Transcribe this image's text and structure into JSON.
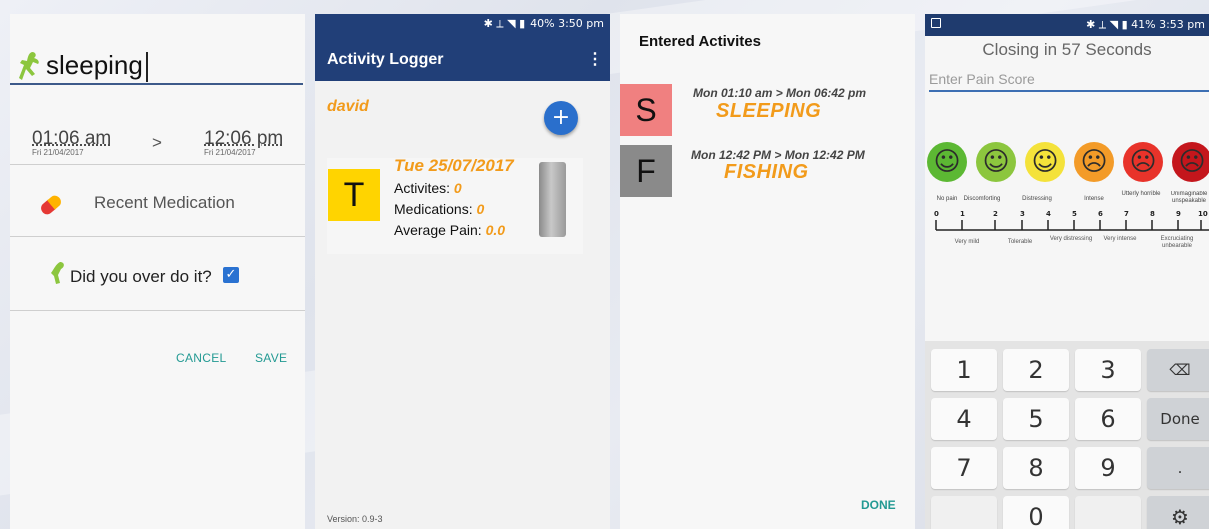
{
  "screen1": {
    "title": "sleeping",
    "start_time": "01:06 am",
    "start_date": "Fri 21/04/2017",
    "arrow": ">",
    "end_time": "12:06 pm",
    "end_date": "Fri 21/04/2017",
    "medication_label": "Recent Medication",
    "overdo_label": "Did you over do it?",
    "overdo_checked": true,
    "cancel_label": "CANCEL",
    "save_label": "SAVE",
    "accent_color": "#239a93"
  },
  "screen2": {
    "status": "40%  3:50 pm",
    "app_title": "Activity Logger",
    "menu_icon": "⋮",
    "user": "david",
    "fab_icon": "+",
    "card": {
      "letter": "T",
      "date": "Tue 25/07/2017",
      "activities_label": "Activites:",
      "activities_value": "0",
      "medications_label": "Medications:",
      "medications_value": "0",
      "pain_label": "Average Pain:",
      "pain_value": "0.0"
    },
    "version": "Version: 0.9-3",
    "brand_color": "#213f78"
  },
  "screen3": {
    "title": "Entered Activites",
    "entries": [
      {
        "letter": "S",
        "range": "Mon 01:10 am > Mon 06:42 pm",
        "name": "SLEEPING",
        "color": "#f08080"
      },
      {
        "letter": "F",
        "range": "Mon 12:42 PM > Mon 12:42 PM",
        "name": "FISHING",
        "color": "#8a8a8a"
      }
    ],
    "done_label": "DONE"
  },
  "screen4": {
    "status": "41%  3:53 pm",
    "closing": "Closing in 57 Seconds",
    "placeholder": "Enter Pain Score",
    "faces": [
      {
        "label": "No pain",
        "color": "#5cb833"
      },
      {
        "label": "Discomforting",
        "color": "#8cc63e"
      },
      {
        "label": "Distressing",
        "color": "#f4e23a"
      },
      {
        "label": "Intense",
        "color": "#f39b28"
      },
      {
        "label": "Utterly horrible",
        "color": "#e8332a"
      },
      {
        "label": "Unimaginable unspeakable",
        "color": "#c4161c"
      }
    ],
    "scale_numbers": [
      "0",
      "1",
      "2",
      "3",
      "4",
      "5",
      "6",
      "7",
      "8",
      "9",
      "10"
    ],
    "scale_sublabels": [
      "Very mild",
      "Tolerable",
      "Very distressing",
      "Very intense",
      "Excruciating unbearable"
    ],
    "keypad": [
      [
        "1",
        "2",
        "3",
        "⌫"
      ],
      [
        "4",
        "5",
        "6",
        "Done"
      ],
      [
        "7",
        "8",
        "9",
        "."
      ],
      [
        "",
        "0",
        "",
        "⚙"
      ]
    ]
  }
}
